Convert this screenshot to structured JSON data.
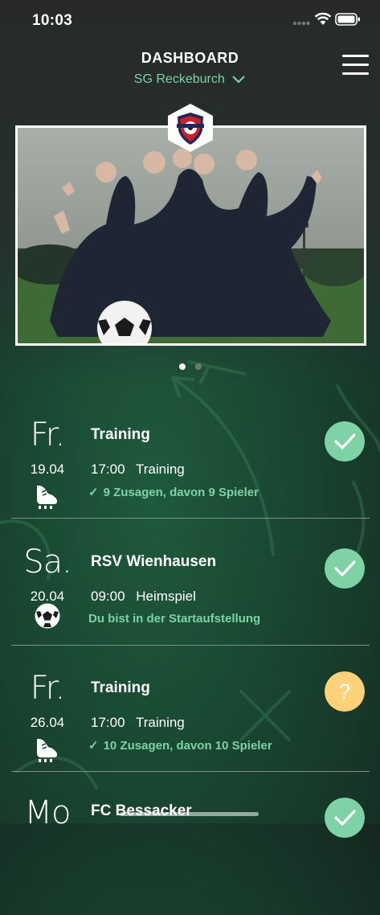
{
  "status_bar": {
    "time": "10:03"
  },
  "header": {
    "title": "DASHBOARD",
    "club": "SG Reckeburch"
  },
  "banner": {
    "pages": 2,
    "active_page": 1
  },
  "events": [
    {
      "day": "Fr.",
      "date": "19.04",
      "icon": "boot-icon",
      "title": "Training",
      "time": "17:00",
      "type": "Training",
      "note": "9 Zusagen, davon 9 Spieler",
      "note_check": true,
      "status": "confirmed",
      "status_color": "#7fd1a6"
    },
    {
      "day": "Sa.",
      "date": "20.04",
      "icon": "ball-icon",
      "title": "RSV Wienhausen",
      "time": "09:00",
      "type": "Heimspiel",
      "note": "Du bist in der Startaufstellung",
      "note_check": false,
      "status": "confirmed",
      "status_color": "#7fd1a6"
    },
    {
      "day": "Fr.",
      "date": "26.04",
      "icon": "boot-icon",
      "title": "Training",
      "time": "17:00",
      "type": "Training",
      "note": "10 Zusagen, davon 10 Spieler",
      "note_check": true,
      "status": "pending",
      "status_color": "#ffd27a"
    },
    {
      "day": "Mo",
      "title": "FC Bessacker",
      "status": "confirmed",
      "status_color": "#7fd1a6"
    }
  ]
}
